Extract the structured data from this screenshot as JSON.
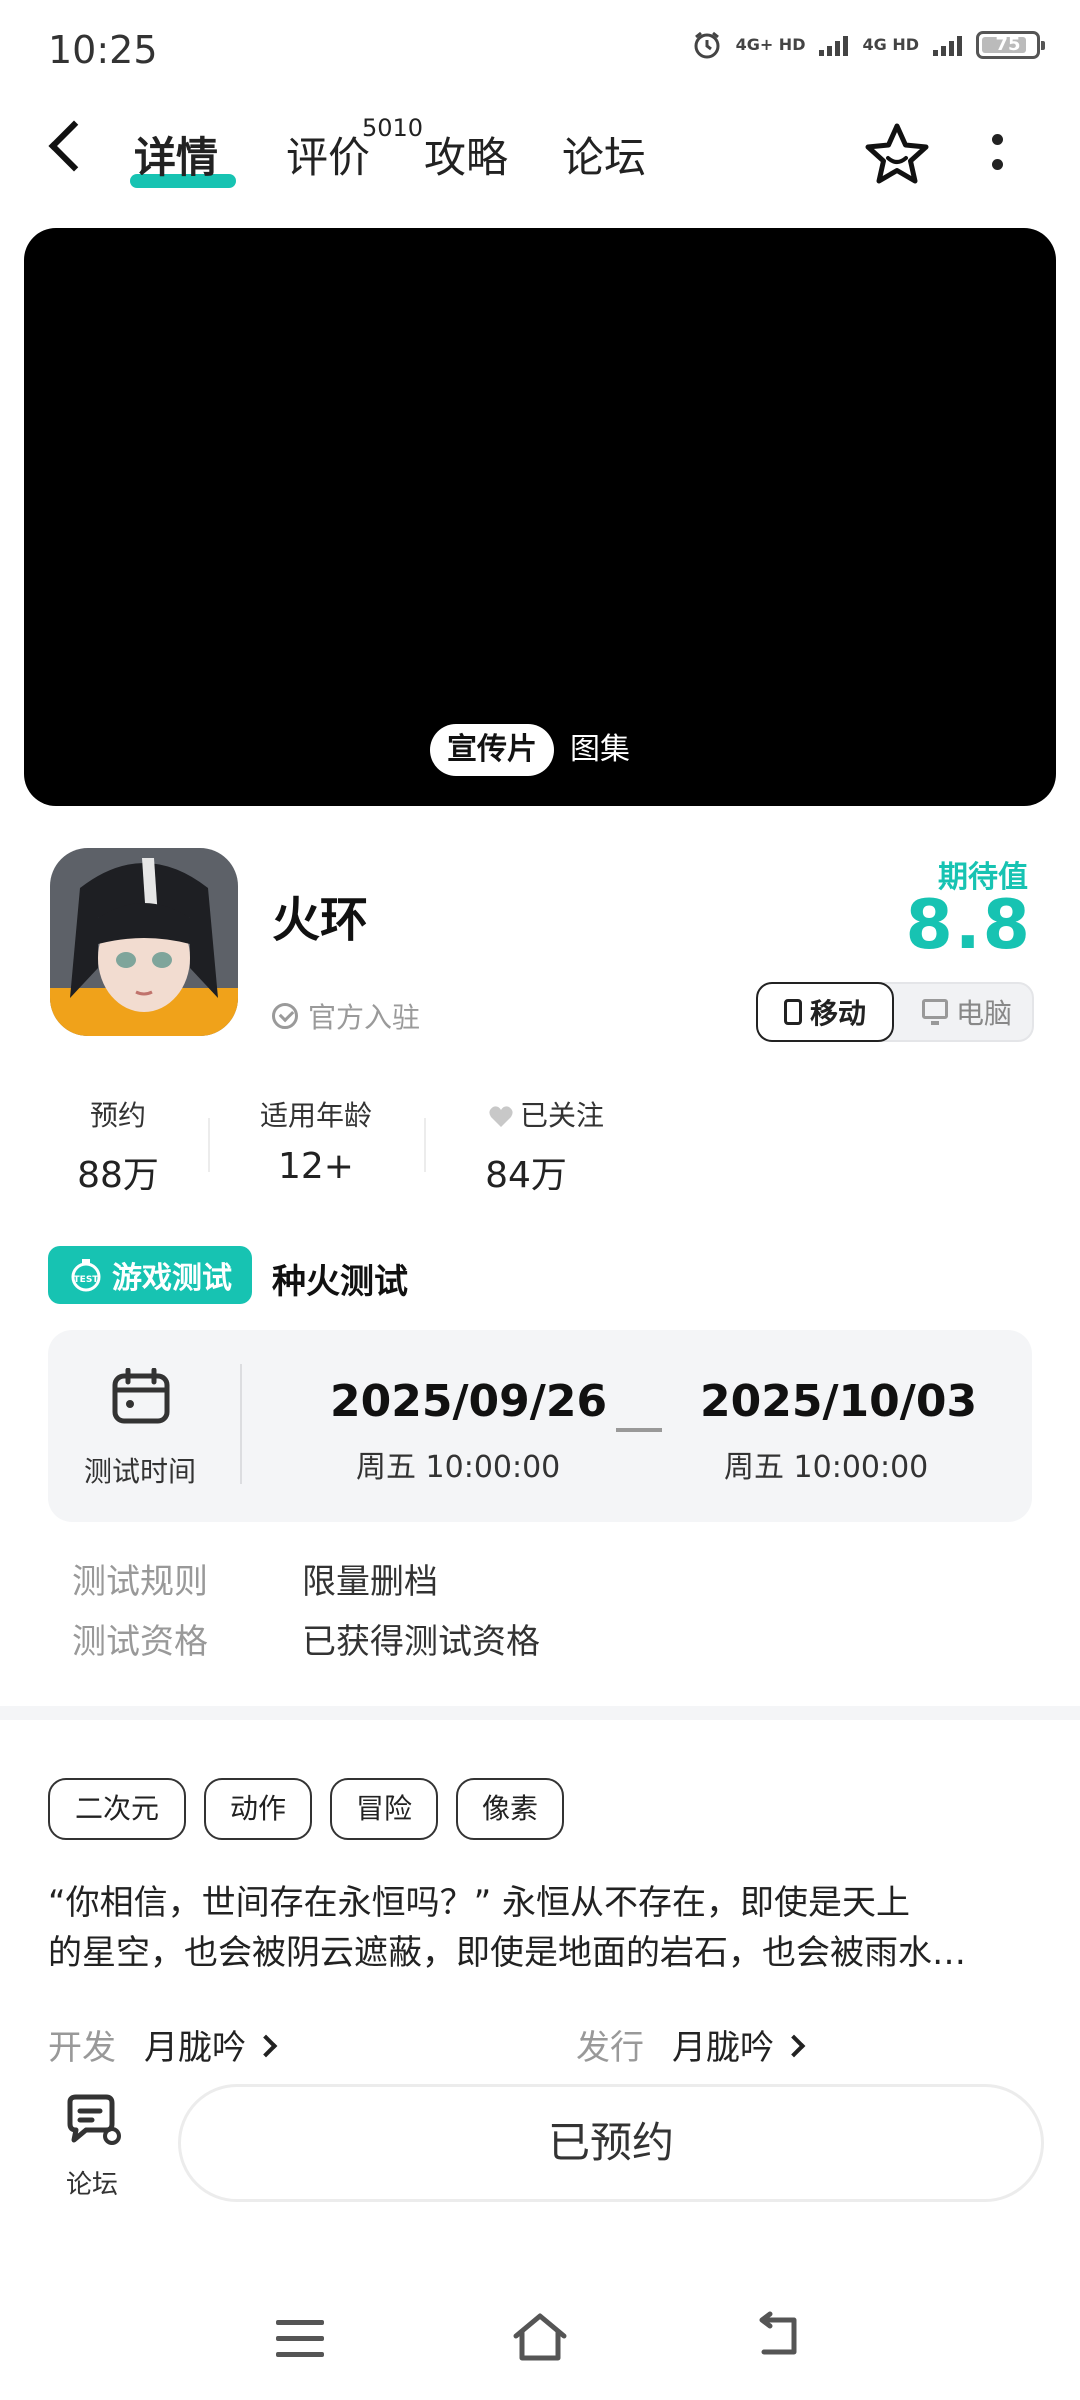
{
  "status_bar": {
    "time": "10:25",
    "net1": "4G+ HD",
    "net2": "4G HD",
    "battery": "75",
    "icons": [
      "alarm-icon",
      "signal-icon",
      "battery-icon"
    ]
  },
  "nav": {
    "tabs": [
      {
        "label": "详情",
        "active": true
      },
      {
        "label": "评价",
        "badge": "5010"
      },
      {
        "label": "攻略"
      },
      {
        "label": "论坛"
      }
    ],
    "icons": [
      "back-icon",
      "star-icon",
      "more-icon"
    ]
  },
  "media": {
    "seg_video": "宣传片",
    "seg_gallery": "图集"
  },
  "app": {
    "name": "火环",
    "official": "官方入驻",
    "expect_label": "期待值",
    "expect_score": "8.8",
    "platform_mobile": "移动",
    "platform_pc": "电脑"
  },
  "stats": [
    {
      "label": "预约",
      "value": "88万"
    },
    {
      "label": "适用年龄",
      "value": "12+"
    },
    {
      "label": "已关注",
      "value": "84万"
    }
  ],
  "test": {
    "badge": "游戏测试",
    "name": "种火测试",
    "time_label": "测试时间",
    "start_date": "2025/09/26",
    "start_time": "周五  10:00:00",
    "end_date": "2025/10/03",
    "end_time": "周五  10:00:00",
    "rules": [
      {
        "key": "测试规则",
        "value": "限量删档"
      },
      {
        "key": "测试资格",
        "value": "已获得测试资格"
      }
    ]
  },
  "tags": [
    "二次元",
    "动作",
    "冒险",
    "像素"
  ],
  "description": {
    "line1": "“你相信，世间存在永恒吗？” 永恒从不存在，即使是天上",
    "line2": "的星空，也会被阴云遮蔽，即使是地面的岩石，也会被雨水…"
  },
  "meta": {
    "dev_key": "开发",
    "dev_val": "月胧吟",
    "pub_key": "发行",
    "pub_val": "月胧吟"
  },
  "bottom": {
    "forum_label": "论坛",
    "reserve_label": "已预约"
  },
  "colors": {
    "accent": "#17c3b2"
  }
}
